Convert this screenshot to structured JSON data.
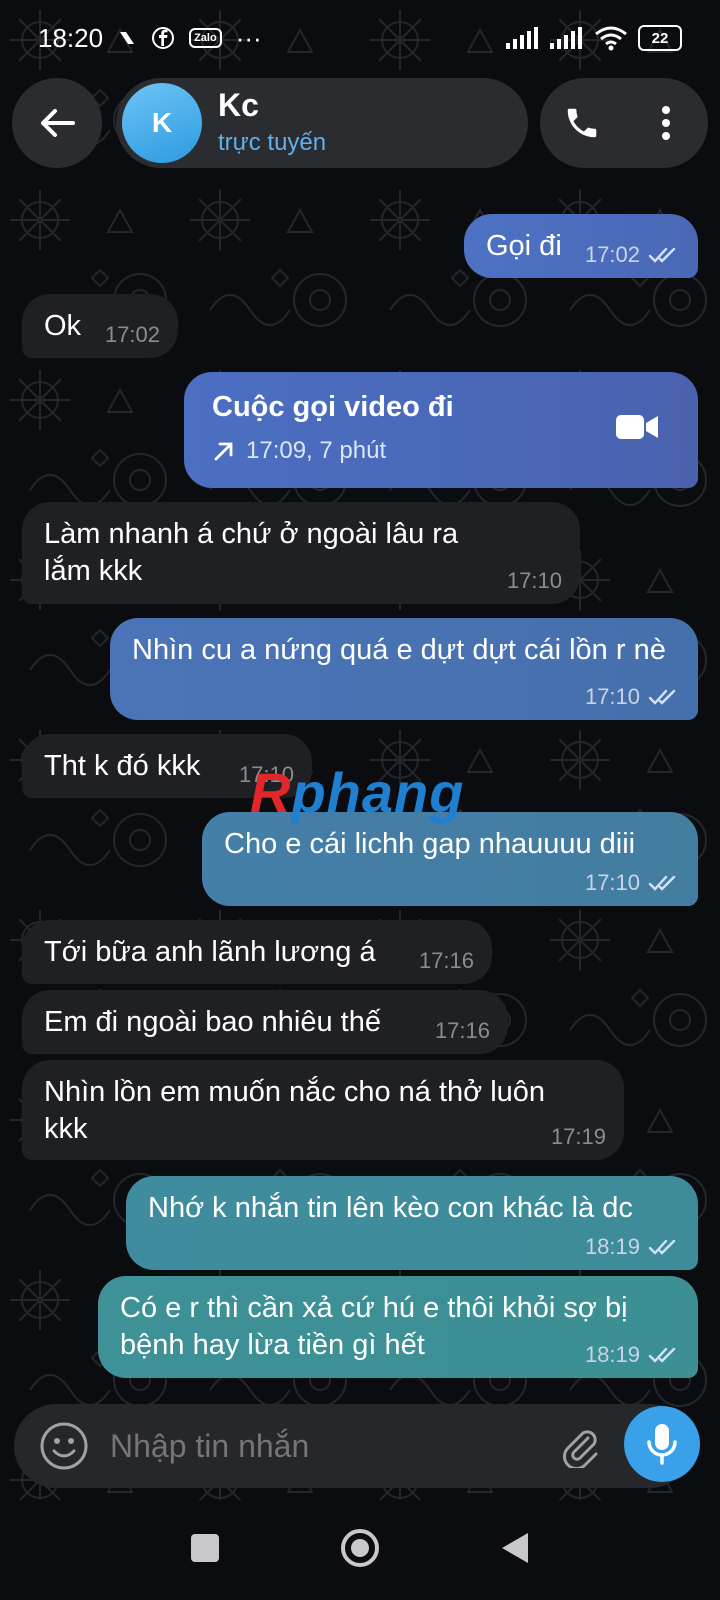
{
  "status_bar": {
    "time": "18:20",
    "icons": [
      "nfc-icon",
      "facebook-icon",
      "zalo-icon",
      "more-dots-icon"
    ],
    "zalo_label": "Zalo",
    "more_label": "···",
    "battery": "22"
  },
  "header": {
    "avatar_letter": "K",
    "contact_name": "Kc",
    "contact_status": "trực tuyến"
  },
  "messages": [
    {
      "dir": "out",
      "text": "Gọi đi",
      "time": "17:02",
      "read": true
    },
    {
      "dir": "in",
      "text": "Ok",
      "time": "17:02"
    },
    {
      "dir": "out",
      "type": "call",
      "title": "Cuộc gọi video đi",
      "sub": "17:09, 7 phút"
    },
    {
      "dir": "in",
      "text": "Làm nhanh á chứ ở ngoài lâu ra lắm kkk",
      "time": "17:10"
    },
    {
      "dir": "out",
      "text": "Nhìn cu a nứng quá e dựt dựt cái lồn r nè",
      "time": "17:10",
      "read": true
    },
    {
      "dir": "in",
      "text": "Tht k đó kkk",
      "time": "17:10"
    },
    {
      "dir": "out",
      "text": "Cho e cái lichh gap nhauuuu diii",
      "time": "17:10",
      "read": true
    },
    {
      "dir": "in",
      "text": "Tới bữa anh lãnh lương á",
      "time": "17:16"
    },
    {
      "dir": "in",
      "text": "Em đi ngoài bao nhiêu thế",
      "time": "17:16"
    },
    {
      "dir": "in",
      "text": "Nhìn lồn em muốn nắc cho ná thở luôn kkk",
      "time": "17:19"
    },
    {
      "dir": "out",
      "text": "Nhớ k nhắn tin lên kèo con khác là dc",
      "time": "18:19",
      "read": true
    },
    {
      "dir": "out",
      "text": "Có e r thì cần xả cứ hú e thôi khỏi sợ bị bệnh hay lừa tiền gì hết",
      "time": "18:19",
      "read": true
    }
  ],
  "watermark": {
    "text_r": "R",
    "text_rest": "phang"
  },
  "input": {
    "placeholder": "Nhập tin nhắn"
  },
  "colors": {
    "accent": "#3aa0ea",
    "bubble_in": "#1f2023",
    "out_gradient_top": "#5a6fc0",
    "out_gradient_bottom": "#3f8f9a",
    "status_online": "#5fb0ee"
  },
  "nav": {
    "buttons": [
      "recents-square",
      "home-circle",
      "back-triangle"
    ]
  }
}
